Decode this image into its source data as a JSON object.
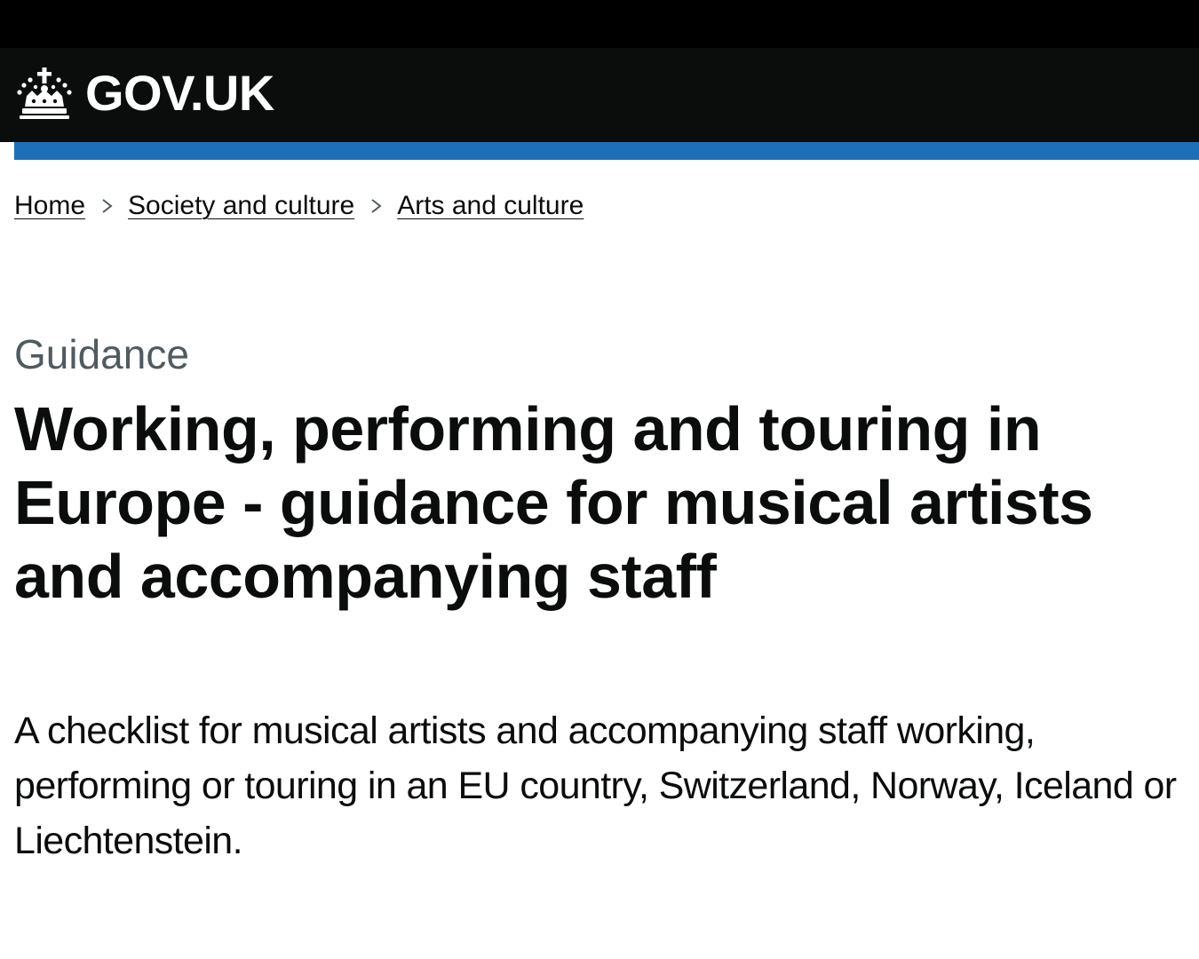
{
  "header": {
    "logo_text": "GOV.UK",
    "logo_icon": "crown-icon",
    "background_color": "#0b0c0c",
    "accent_bar_color": "#1d70b8"
  },
  "breadcrumbs": [
    {
      "label": "Home"
    },
    {
      "label": "Society and culture"
    },
    {
      "label": "Arts and culture"
    }
  ],
  "breadcrumb_separator_icon": "chevron-right-icon",
  "page": {
    "caption": "Guidance",
    "title": "Working, performing and touring in Europe - guidance for musical artists and accompanying staff",
    "summary": "A checklist for musical artists and accompanying staff working, performing or touring in an EU country, Switzerland, Norway, Iceland or Liechtenstein."
  }
}
